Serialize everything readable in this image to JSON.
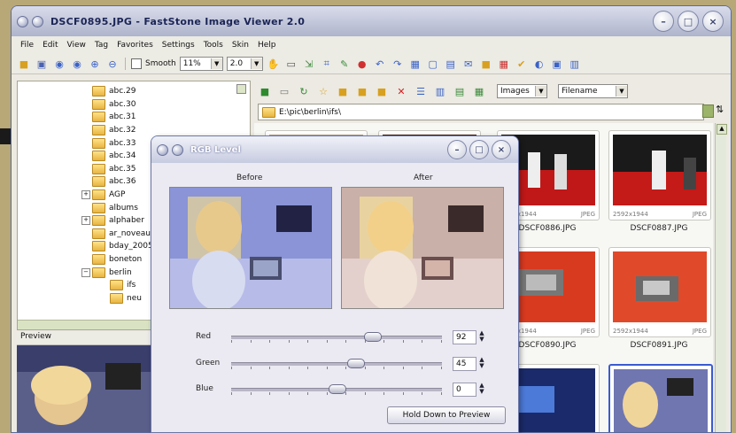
{
  "window": {
    "title": "DSCF0895.JPG - FastStone Image Viewer 2.0"
  },
  "menu": [
    "File",
    "Edit",
    "View",
    "Tag",
    "Favorites",
    "Settings",
    "Tools",
    "Skin",
    "Help"
  ],
  "toolbar": {
    "smooth_label": "Smooth",
    "zoom_value": "11%",
    "ratio_value": "2.0"
  },
  "tree": {
    "items": [
      {
        "label": "abc.29",
        "expander": false
      },
      {
        "label": "abc.30",
        "expander": false
      },
      {
        "label": "abc.31",
        "expander": false
      },
      {
        "label": "abc.32",
        "expander": false
      },
      {
        "label": "abc.33",
        "expander": false
      },
      {
        "label": "abc.34",
        "expander": false
      },
      {
        "label": "abc.35",
        "expander": false
      },
      {
        "label": "abc.36",
        "expander": false
      },
      {
        "label": "AGP",
        "expander": true
      },
      {
        "label": "albums",
        "expander": false
      },
      {
        "label": "alphaber",
        "expander": true
      },
      {
        "label": "ar_noveau",
        "expander": false
      },
      {
        "label": "bday_2005",
        "expander": false
      },
      {
        "label": "boneton",
        "expander": false
      },
      {
        "label": "berlin",
        "expander": true,
        "open": true
      },
      {
        "label": "ifs",
        "expander": false,
        "child": true
      },
      {
        "label": "neu",
        "expander": false,
        "child": true
      }
    ]
  },
  "preview": {
    "label": "Preview"
  },
  "browser": {
    "filter_value": "Images",
    "sort_value": "Filename",
    "path": "E:\\pic\\berlin\\ifs\\",
    "thumbs": [
      {
        "name": "DSCF0886.JPG",
        "dims": "2592x1944",
        "type": "JPEG"
      },
      {
        "name": "DSCF0887.JPG",
        "dims": "2592x1944",
        "type": "JPEG"
      },
      {
        "name": "DSCF0890.JPG",
        "dims": "2592x1944",
        "type": "JPEG"
      },
      {
        "name": "DSCF0891.JPG",
        "dims": "2592x1944",
        "type": "JPEG"
      }
    ]
  },
  "dialog": {
    "title": "RGB Level",
    "before_label": "Before",
    "after_label": "After",
    "sliders": [
      {
        "label": "Red",
        "value": "92",
        "fraction": 0.67
      },
      {
        "label": "Green",
        "value": "45",
        "fraction": 0.59
      },
      {
        "label": "Blue",
        "value": "0",
        "fraction": 0.5
      }
    ],
    "hold_button": "Hold Down to Preview"
  },
  "colors": {
    "titlebar": "#aeb4cc",
    "accent": "#1b2556",
    "folder": "#e8b440"
  }
}
